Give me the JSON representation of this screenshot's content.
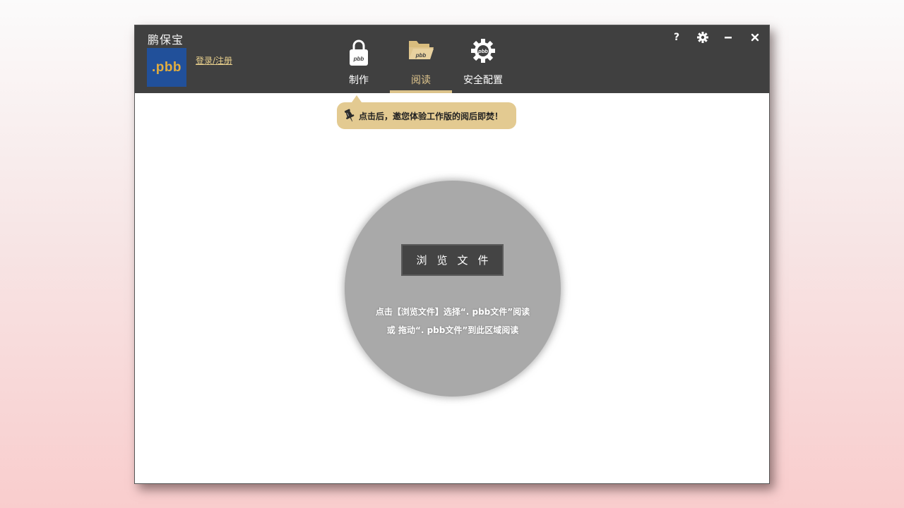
{
  "app": {
    "name": "鹏保宝",
    "logo_text": ".pbb",
    "login_link": "登录/注册"
  },
  "nav": {
    "tabs": [
      {
        "label": "制作",
        "icon": "lock-pbb-icon",
        "active": false
      },
      {
        "label": "阅读",
        "icon": "folder-pbb-icon",
        "active": true
      },
      {
        "label": "安全配置",
        "icon": "gear-pbb-icon",
        "active": false
      }
    ],
    "icon_badge": "pbb"
  },
  "window_controls": {
    "help": "?",
    "settings_icon": "gear-icon",
    "minimize_icon": "minimize-icon",
    "close_icon": "close-icon"
  },
  "tooltip": {
    "icon": "pin-icon",
    "text": "点击后，邀您体验工作版的阅后即焚！"
  },
  "drop_zone": {
    "browse_button": "浏览文件",
    "hint_line1": "点击【浏览文件】选择“. pbb文件”阅读",
    "hint_line2": "或  拖动“. pbb文件”到此区域阅读"
  },
  "colors": {
    "titlebar": "#404040",
    "accent": "#e0c68e",
    "logo_bg": "#21509a",
    "logo_text": "#e2ad3f",
    "circle": "#a9a9a9"
  }
}
